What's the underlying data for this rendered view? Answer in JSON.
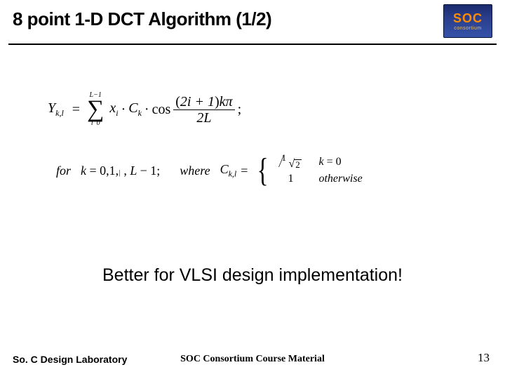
{
  "header": {
    "title": "8 point 1-D DCT Algorithm (1/2)",
    "logo": {
      "main": "SOC",
      "sub": "consortium"
    }
  },
  "formula": {
    "lhs": "Y",
    "lhs_sub": "k,l",
    "eq": "=",
    "sum_upper": "L−1",
    "sum_lower_var": "i",
    "sum_lower_val": "0",
    "x": "x",
    "x_sub": "i",
    "dot": "·",
    "C": "C",
    "C_sub": "k",
    "cos": "cos",
    "frac_num": "(2i + 1)kπ",
    "frac_den": "2L",
    "semicolon": ";",
    "for": "for",
    "k_eq": "k = 0,1,",
    "ellipsis_txt": " , L − 1;",
    "where": "where",
    "C2": "C",
    "C2_sub": "k,l",
    "eq2": "=",
    "case1_num": "1",
    "case1_rad": "2",
    "case1_cond": "k = 0",
    "case2_val": "1",
    "case2_cond": "otherwise"
  },
  "tagline": "Better for VLSI design implementation!",
  "footer": {
    "left": "So. C Design Laboratory",
    "center": "SOC Consortium Course Material",
    "page": "13"
  }
}
